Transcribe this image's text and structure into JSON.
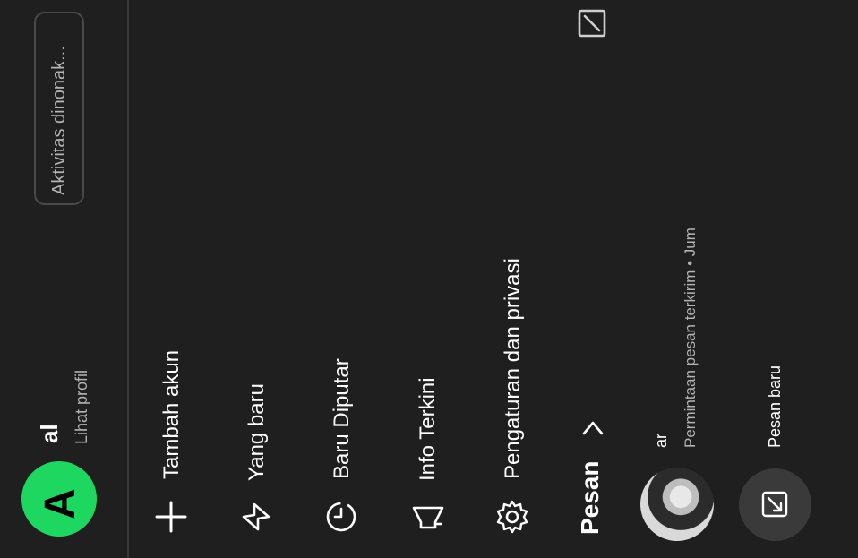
{
  "status": {
    "activity_label": "Aktivitas dinonak..."
  },
  "profile": {
    "avatar_letter": "A",
    "name": "al",
    "view_profile": "Lihat profil"
  },
  "menu": {
    "items": [
      {
        "label": "Tambah akun",
        "icon": "plus-icon"
      },
      {
        "label": "Yang baru",
        "icon": "lightning-icon"
      },
      {
        "label": "Baru Diputar",
        "icon": "clock-history-icon"
      },
      {
        "label": "Info Terkini",
        "icon": "megaphone-icon"
      },
      {
        "label": "Pengaturan dan privasi",
        "icon": "gear-icon"
      }
    ]
  },
  "messages": {
    "title": "Pesan",
    "items": [
      {
        "name": "ar",
        "subtitle": "Permintaan pesan terkirim • Jum"
      }
    ],
    "new_message_label": "Pesan baru"
  },
  "colors": {
    "background": "#1f1f1f",
    "accent": "#1ed760",
    "muted_text": "#b3b3b3"
  }
}
